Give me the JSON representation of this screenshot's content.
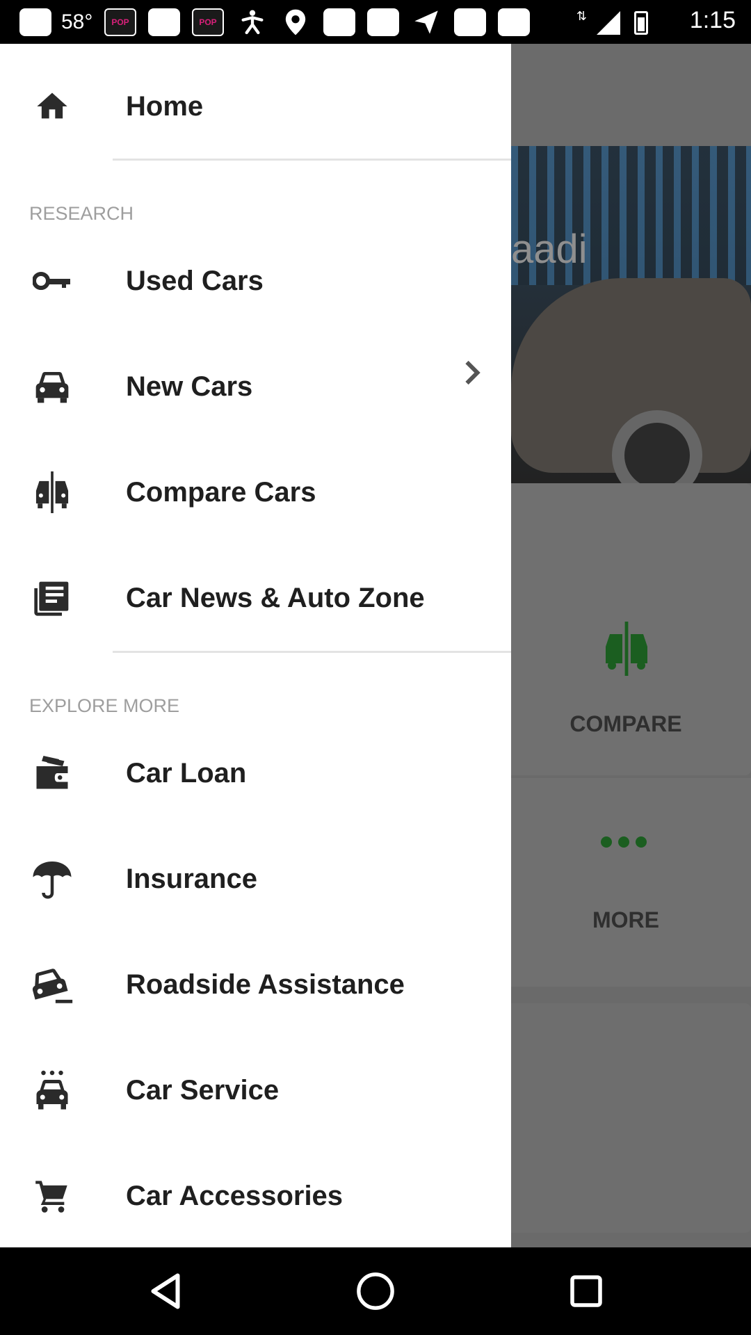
{
  "status_bar": {
    "temperature": "58°",
    "time": "1:15",
    "pop_badge": "POP"
  },
  "background": {
    "brand_partial": "aadi",
    "compare_label": "COMPARE",
    "more_label": "MORE"
  },
  "drawer": {
    "home": {
      "label": "Home",
      "icon": "home-icon"
    },
    "research_header": "RESEARCH",
    "research_items": [
      {
        "label": "Used Cars",
        "icon": "key-icon"
      },
      {
        "label": "New Cars",
        "icon": "car-icon",
        "has_chevron": true
      },
      {
        "label": "Compare Cars",
        "icon": "compare-cars-icon"
      },
      {
        "label": "Car News & Auto Zone",
        "icon": "news-icon"
      }
    ],
    "explore_header": "EXPLORE MORE",
    "explore_items": [
      {
        "label": "Car Loan",
        "icon": "wallet-icon"
      },
      {
        "label": "Insurance",
        "icon": "umbrella-icon"
      },
      {
        "label": "Roadside Assistance",
        "icon": "roadside-car-icon"
      },
      {
        "label": "Car Service",
        "icon": "car-service-icon"
      },
      {
        "label": "Car Accessories",
        "icon": "cart-icon"
      }
    ]
  },
  "colors": {
    "accent_green": "#1b5e20",
    "drawer_bg": "#ffffff",
    "section_header": "#9e9e9e",
    "scrim": "#6a6a6a"
  }
}
